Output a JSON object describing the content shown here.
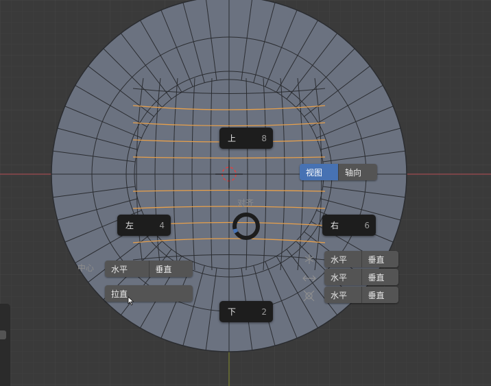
{
  "pie_menu": {
    "top": {
      "label": "上",
      "key": "8"
    },
    "left": {
      "label": "左",
      "key": "4"
    },
    "right": {
      "label": "右",
      "key": "6"
    },
    "bottom": {
      "label": "下",
      "key": "2"
    },
    "align_label": "对齐",
    "center_label": "中心"
  },
  "view_axis_toggle": {
    "options": [
      "视图",
      "轴向"
    ],
    "active": "视图"
  },
  "center_row": {
    "horizontal": "水平",
    "vertical": "垂直",
    "straighten": "拉直"
  },
  "right_rows": [
    {
      "icon": "snowflake-icon",
      "horizontal": "水平",
      "vertical": "垂直"
    },
    {
      "icon": "arrows-horizontal-icon",
      "horizontal": "水平",
      "vertical": "垂直"
    },
    {
      "icon": "target-icon",
      "horizontal": "水平",
      "vertical": "垂直"
    }
  ],
  "colors": {
    "background": "#3a3a3a",
    "mesh_face": "#6b7280",
    "mesh_edge": "#2a2c30",
    "selected_edge": "#e8a04a",
    "accent": "#4772b3",
    "x_axis": "#a04a52",
    "y_axis": "#7a8030"
  }
}
